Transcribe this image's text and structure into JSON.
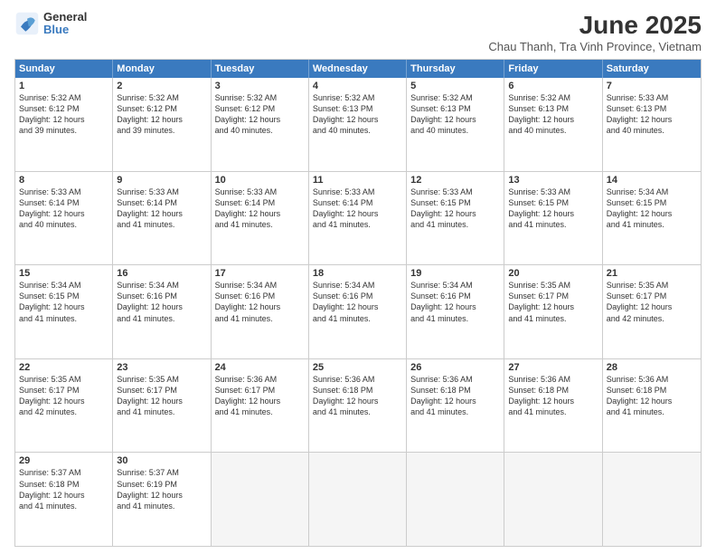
{
  "logo": {
    "general": "General",
    "blue": "Blue"
  },
  "header": {
    "month": "June 2025",
    "location": "Chau Thanh, Tra Vinh Province, Vietnam"
  },
  "weekdays": [
    "Sunday",
    "Monday",
    "Tuesday",
    "Wednesday",
    "Thursday",
    "Friday",
    "Saturday"
  ],
  "rows": [
    [
      {
        "day": "1",
        "lines": [
          "Sunrise: 5:32 AM",
          "Sunset: 6:12 PM",
          "Daylight: 12 hours",
          "and 39 minutes."
        ]
      },
      {
        "day": "2",
        "lines": [
          "Sunrise: 5:32 AM",
          "Sunset: 6:12 PM",
          "Daylight: 12 hours",
          "and 39 minutes."
        ]
      },
      {
        "day": "3",
        "lines": [
          "Sunrise: 5:32 AM",
          "Sunset: 6:12 PM",
          "Daylight: 12 hours",
          "and 40 minutes."
        ]
      },
      {
        "day": "4",
        "lines": [
          "Sunrise: 5:32 AM",
          "Sunset: 6:13 PM",
          "Daylight: 12 hours",
          "and 40 minutes."
        ]
      },
      {
        "day": "5",
        "lines": [
          "Sunrise: 5:32 AM",
          "Sunset: 6:13 PM",
          "Daylight: 12 hours",
          "and 40 minutes."
        ]
      },
      {
        "day": "6",
        "lines": [
          "Sunrise: 5:32 AM",
          "Sunset: 6:13 PM",
          "Daylight: 12 hours",
          "and 40 minutes."
        ]
      },
      {
        "day": "7",
        "lines": [
          "Sunrise: 5:33 AM",
          "Sunset: 6:13 PM",
          "Daylight: 12 hours",
          "and 40 minutes."
        ]
      }
    ],
    [
      {
        "day": "8",
        "lines": [
          "Sunrise: 5:33 AM",
          "Sunset: 6:14 PM",
          "Daylight: 12 hours",
          "and 40 minutes."
        ]
      },
      {
        "day": "9",
        "lines": [
          "Sunrise: 5:33 AM",
          "Sunset: 6:14 PM",
          "Daylight: 12 hours",
          "and 41 minutes."
        ]
      },
      {
        "day": "10",
        "lines": [
          "Sunrise: 5:33 AM",
          "Sunset: 6:14 PM",
          "Daylight: 12 hours",
          "and 41 minutes."
        ]
      },
      {
        "day": "11",
        "lines": [
          "Sunrise: 5:33 AM",
          "Sunset: 6:14 PM",
          "Daylight: 12 hours",
          "and 41 minutes."
        ]
      },
      {
        "day": "12",
        "lines": [
          "Sunrise: 5:33 AM",
          "Sunset: 6:15 PM",
          "Daylight: 12 hours",
          "and 41 minutes."
        ]
      },
      {
        "day": "13",
        "lines": [
          "Sunrise: 5:33 AM",
          "Sunset: 6:15 PM",
          "Daylight: 12 hours",
          "and 41 minutes."
        ]
      },
      {
        "day": "14",
        "lines": [
          "Sunrise: 5:34 AM",
          "Sunset: 6:15 PM",
          "Daylight: 12 hours",
          "and 41 minutes."
        ]
      }
    ],
    [
      {
        "day": "15",
        "lines": [
          "Sunrise: 5:34 AM",
          "Sunset: 6:15 PM",
          "Daylight: 12 hours",
          "and 41 minutes."
        ]
      },
      {
        "day": "16",
        "lines": [
          "Sunrise: 5:34 AM",
          "Sunset: 6:16 PM",
          "Daylight: 12 hours",
          "and 41 minutes."
        ]
      },
      {
        "day": "17",
        "lines": [
          "Sunrise: 5:34 AM",
          "Sunset: 6:16 PM",
          "Daylight: 12 hours",
          "and 41 minutes."
        ]
      },
      {
        "day": "18",
        "lines": [
          "Sunrise: 5:34 AM",
          "Sunset: 6:16 PM",
          "Daylight: 12 hours",
          "and 41 minutes."
        ]
      },
      {
        "day": "19",
        "lines": [
          "Sunrise: 5:34 AM",
          "Sunset: 6:16 PM",
          "Daylight: 12 hours",
          "and 41 minutes."
        ]
      },
      {
        "day": "20",
        "lines": [
          "Sunrise: 5:35 AM",
          "Sunset: 6:17 PM",
          "Daylight: 12 hours",
          "and 41 minutes."
        ]
      },
      {
        "day": "21",
        "lines": [
          "Sunrise: 5:35 AM",
          "Sunset: 6:17 PM",
          "Daylight: 12 hours",
          "and 42 minutes."
        ]
      }
    ],
    [
      {
        "day": "22",
        "lines": [
          "Sunrise: 5:35 AM",
          "Sunset: 6:17 PM",
          "Daylight: 12 hours",
          "and 42 minutes."
        ]
      },
      {
        "day": "23",
        "lines": [
          "Sunrise: 5:35 AM",
          "Sunset: 6:17 PM",
          "Daylight: 12 hours",
          "and 41 minutes."
        ]
      },
      {
        "day": "24",
        "lines": [
          "Sunrise: 5:36 AM",
          "Sunset: 6:17 PM",
          "Daylight: 12 hours",
          "and 41 minutes."
        ]
      },
      {
        "day": "25",
        "lines": [
          "Sunrise: 5:36 AM",
          "Sunset: 6:18 PM",
          "Daylight: 12 hours",
          "and 41 minutes."
        ]
      },
      {
        "day": "26",
        "lines": [
          "Sunrise: 5:36 AM",
          "Sunset: 6:18 PM",
          "Daylight: 12 hours",
          "and 41 minutes."
        ]
      },
      {
        "day": "27",
        "lines": [
          "Sunrise: 5:36 AM",
          "Sunset: 6:18 PM",
          "Daylight: 12 hours",
          "and 41 minutes."
        ]
      },
      {
        "day": "28",
        "lines": [
          "Sunrise: 5:36 AM",
          "Sunset: 6:18 PM",
          "Daylight: 12 hours",
          "and 41 minutes."
        ]
      }
    ],
    [
      {
        "day": "29",
        "lines": [
          "Sunrise: 5:37 AM",
          "Sunset: 6:18 PM",
          "Daylight: 12 hours",
          "and 41 minutes."
        ]
      },
      {
        "day": "30",
        "lines": [
          "Sunrise: 5:37 AM",
          "Sunset: 6:19 PM",
          "Daylight: 12 hours",
          "and 41 minutes."
        ]
      },
      {
        "day": "",
        "lines": []
      },
      {
        "day": "",
        "lines": []
      },
      {
        "day": "",
        "lines": []
      },
      {
        "day": "",
        "lines": []
      },
      {
        "day": "",
        "lines": []
      }
    ]
  ]
}
